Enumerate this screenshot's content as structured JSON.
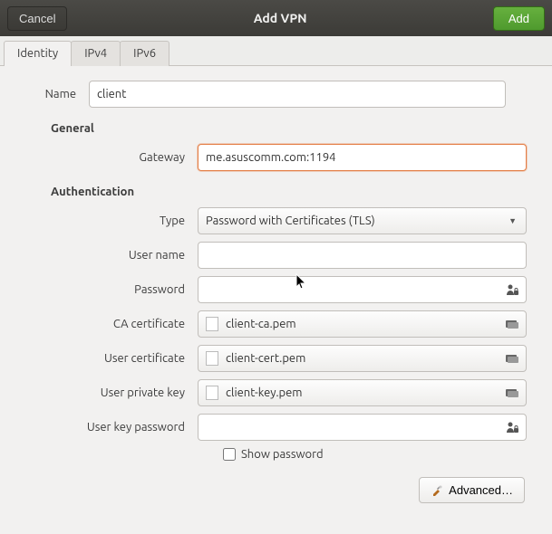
{
  "titlebar": {
    "cancel": "Cancel",
    "title": "Add VPN",
    "add": "Add"
  },
  "tabs": {
    "identity": "Identity",
    "ipv4": "IPv4",
    "ipv6": "IPv6"
  },
  "fields": {
    "name_label": "Name",
    "name_value": "client"
  },
  "sections": {
    "general": "General",
    "auth": "Authentication"
  },
  "general": {
    "gateway_label": "Gateway",
    "gateway_value": "me.asuscomm.com:1194"
  },
  "auth": {
    "type_label": "Type",
    "type_value": "Password with Certificates (TLS)",
    "username_label": "User name",
    "username_value": "",
    "password_label": "Password",
    "password_value": "",
    "ca_label": "CA certificate",
    "ca_value": "client-ca.pem",
    "usercert_label": "User certificate",
    "usercert_value": "client-cert.pem",
    "userkey_label": "User private key",
    "userkey_value": "client-key.pem",
    "keypw_label": "User key password",
    "keypw_value": "",
    "showpw_label": "Show password"
  },
  "advanced": "Advanced…"
}
